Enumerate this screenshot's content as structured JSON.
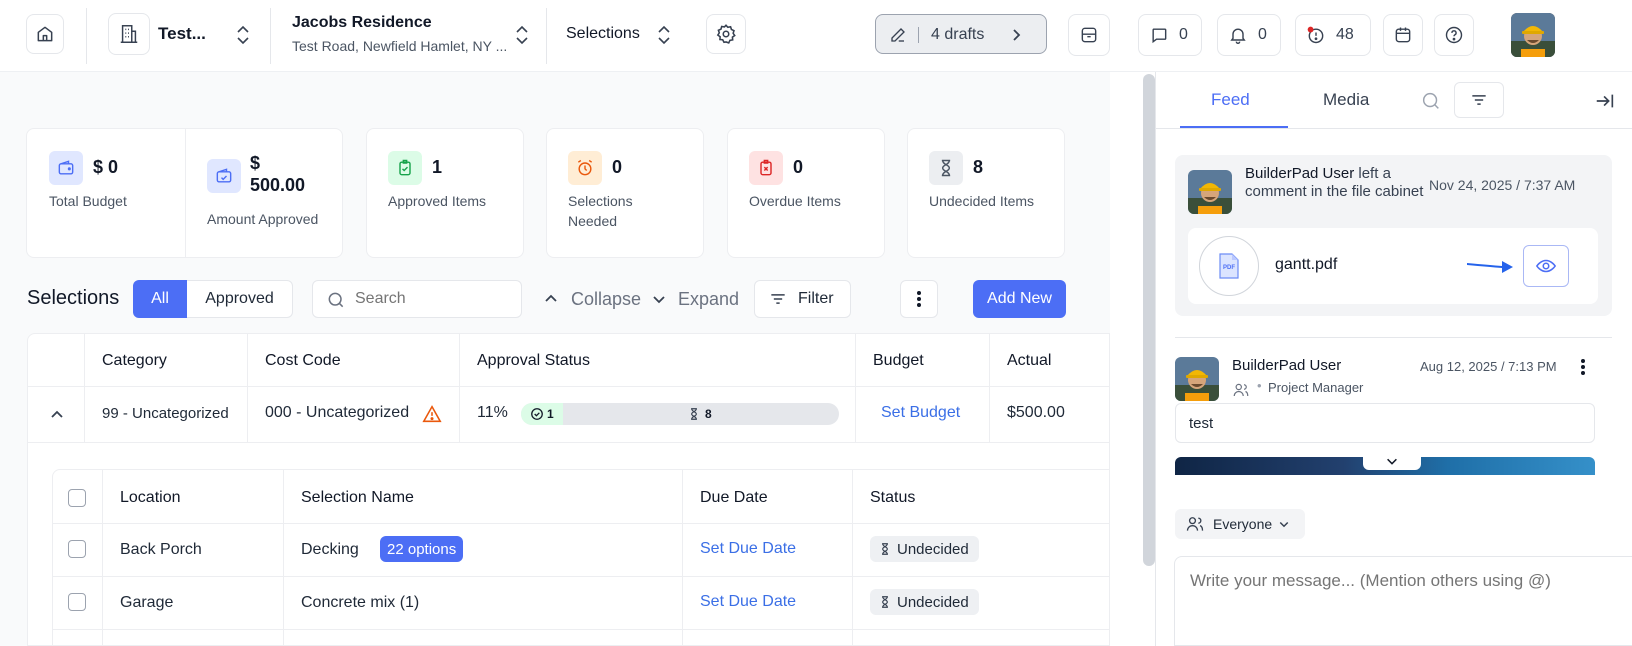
{
  "topbar": {
    "company": "Test...",
    "project_name": "Jacobs Residence",
    "project_address": "Test Road, Newfield Hamlet, NY ...",
    "module": "Selections",
    "drafts": "4 drafts",
    "messages_count": "0",
    "notifications_count": "0",
    "alerts_count": "48"
  },
  "cards": [
    {
      "value": "$ 0",
      "label": "Total Budget"
    },
    {
      "value": "$ 500.00",
      "label": "Amount Approved"
    },
    {
      "value": "1",
      "label": "Approved Items"
    },
    {
      "value": "0",
      "label": "Selections Needed"
    },
    {
      "value": "0",
      "label": "Overdue Items"
    },
    {
      "value": "8",
      "label": "Undecided Items"
    }
  ],
  "toolbar": {
    "title": "Selections",
    "filter_all": "All",
    "filter_approved": "Approved",
    "search_placeholder": "Search",
    "collapse": "Collapse",
    "expand": "Expand",
    "filter": "Filter",
    "add_new": "Add New"
  },
  "table": {
    "headers": [
      "Category",
      "Cost Code",
      "Approval Status",
      "Budget",
      "Actual"
    ],
    "row": {
      "category": "99 - Uncategorized",
      "cost_code": "000 - Uncategorized",
      "approval_percent": "11%",
      "approved_count": "1",
      "undecided_count": "8",
      "approval_progress": 0.11,
      "budget": "Set Budget",
      "actual": "$500.00"
    }
  },
  "subtable": {
    "headers": [
      "Location",
      "Selection Name",
      "Due Date",
      "Status"
    ],
    "rows": [
      {
        "location": "Back Porch",
        "name": "Decking",
        "options": "22 options",
        "due": "Set Due Date",
        "status": "Undecided"
      },
      {
        "location": "Garage",
        "name": "Concrete mix (1)",
        "options": "",
        "due": "Set Due Date",
        "status": "Undecided"
      }
    ]
  },
  "panel": {
    "tabs": [
      "Feed",
      "Media"
    ],
    "feed": [
      {
        "author": "BuilderPad User",
        "action": " left a comment in the file cabinet",
        "time": "Nov 24, 2025 / 7:37 AM",
        "file": "gantt.pdf",
        "file_badge": "PDF"
      },
      {
        "author": "BuilderPad User",
        "role": "Project Manager",
        "time": "Aug 12, 2025 / 7:13 PM",
        "comment": "test"
      }
    ],
    "audience": "Everyone",
    "message_placeholder": "Write your message... (Mention others using @)"
  },
  "colors": {
    "accent": "#4c6ef5",
    "link": "#3b6fe6",
    "approved_green": "#dcfce7",
    "alert_red": "#dc2626"
  }
}
